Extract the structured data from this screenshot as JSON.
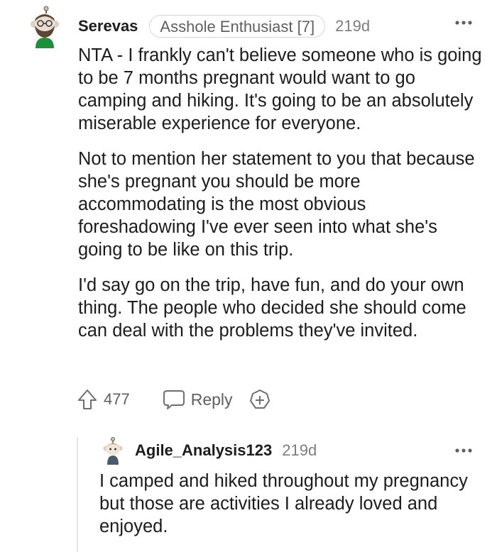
{
  "comment": {
    "username": "Serevas",
    "flair": "Asshole Enthusiast [7]",
    "age": "219d",
    "paragraphs": [
      "NTA - I frankly can't believe someone who is going to be 7 months pregnant would want to go camping and hiking. It's going to be an absolutely miserable experience for everyone.",
      "Not to mention her statement to you that because she's pregnant you should be more accommodating is the most obvious foreshadowing I've ever seen into what she's going to be like on this trip.",
      "I'd say go on the trip, have fun, and do your own thing. The people who decided she should come can deal with the problems they've invited."
    ],
    "score": "477",
    "reply_label": "Reply",
    "icons": {
      "upvote": "upvote-arrow-icon",
      "reply": "speech-bubble-icon",
      "award": "add-award-icon",
      "more": "more-options-icon"
    }
  },
  "reply": {
    "username": "Agile_Analysis123",
    "age": "219d",
    "paragraphs": [
      "I camped and hiked throughout my pregnancy but those are activities I already loved and enjoyed."
    ]
  },
  "colors": {
    "text": "#1c1c1c",
    "meta": "#7c7c7c",
    "flair_border": "#d6d6d6",
    "avatar_green": "#1e8f3a",
    "thread_line": "#e6e6e6"
  }
}
